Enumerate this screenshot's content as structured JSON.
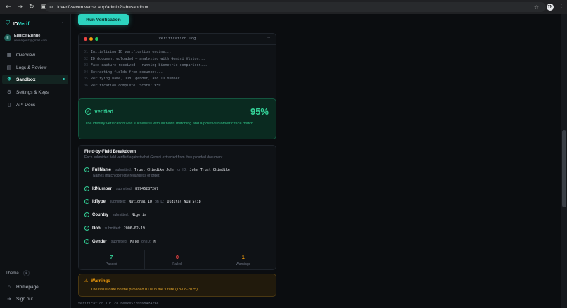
{
  "browser": {
    "url": "idverif-seven.vercel.app/admin?tab=sandbox",
    "profile_initial": "TN"
  },
  "sidebar": {
    "brand_prefix": "ID",
    "brand_suffix": "Verif",
    "user": {
      "initial": "E",
      "name": "Eunice Ezinne",
      "email": "ijeunagenz@gmail.com"
    },
    "items": [
      {
        "label": "Overview",
        "icon": "grid-icon"
      },
      {
        "label": "Logs & Review",
        "icon": "document-icon"
      },
      {
        "label": "Sandbox",
        "icon": "flask-icon",
        "active": true
      },
      {
        "label": "Settings & Keys",
        "icon": "gear-icon"
      },
      {
        "label": "API Docs",
        "icon": "book-icon"
      }
    ],
    "theme_label": "Theme",
    "homepage_label": "Homepage",
    "signout_label": "Sign out"
  },
  "main": {
    "run_button": "Run Verification",
    "log": {
      "filename": "verification.log",
      "lines": [
        {
          "num": "01",
          "text": "Initializing ID verification engine..."
        },
        {
          "num": "02",
          "text": "ID document uploaded — analyzing with Gemini Vision..."
        },
        {
          "num": "03",
          "text": "Face capture received — running biometric comparison..."
        },
        {
          "num": "04",
          "text": "Extracting fields from document..."
        },
        {
          "num": "05",
          "text": "Verifying name, DOB, gender, and ID number..."
        },
        {
          "num": "06",
          "text": "Verification complete. Score: 95%"
        }
      ]
    },
    "result": {
      "status": "Verified",
      "score": "95%",
      "description": "The identity verification was successful with all fields matching and a positive biometric face match."
    },
    "breakdown": {
      "title": "Field-by-Field Breakdown",
      "subtitle": "Each submitted field verified against what Gemini extracted from the uploaded document",
      "submitted_label": "submitted:",
      "on_id_label": "on ID:",
      "fields": [
        {
          "name": "FullName",
          "submitted": "Trust Chimdike John",
          "on_id": "John Trust Chimdike",
          "note": "Names match correctly regardless of order."
        },
        {
          "name": "IdNumber",
          "submitted": "89946287267"
        },
        {
          "name": "IdType",
          "submitted": "National ID",
          "on_id": "Digital NIN Slip"
        },
        {
          "name": "Country",
          "submitted": "Nigeria"
        },
        {
          "name": "Dob",
          "submitted": "2006-02-19"
        },
        {
          "name": "Gender",
          "submitted": "Male",
          "on_id": "M"
        }
      ],
      "stats": [
        {
          "value": "7",
          "label": "Passed",
          "color": "#34d399"
        },
        {
          "value": "0",
          "label": "Failed",
          "color": "#ef4444"
        },
        {
          "value": "1",
          "label": "Warnings",
          "color": "#f59e0b"
        }
      ]
    },
    "warnings": {
      "title": "Warnings",
      "text": "The issue date on the provided ID is in the future (18-08-2025)."
    },
    "verification_id_label": "Verification ID:",
    "verification_id": "c8Jbeexe5226n684z429e"
  }
}
